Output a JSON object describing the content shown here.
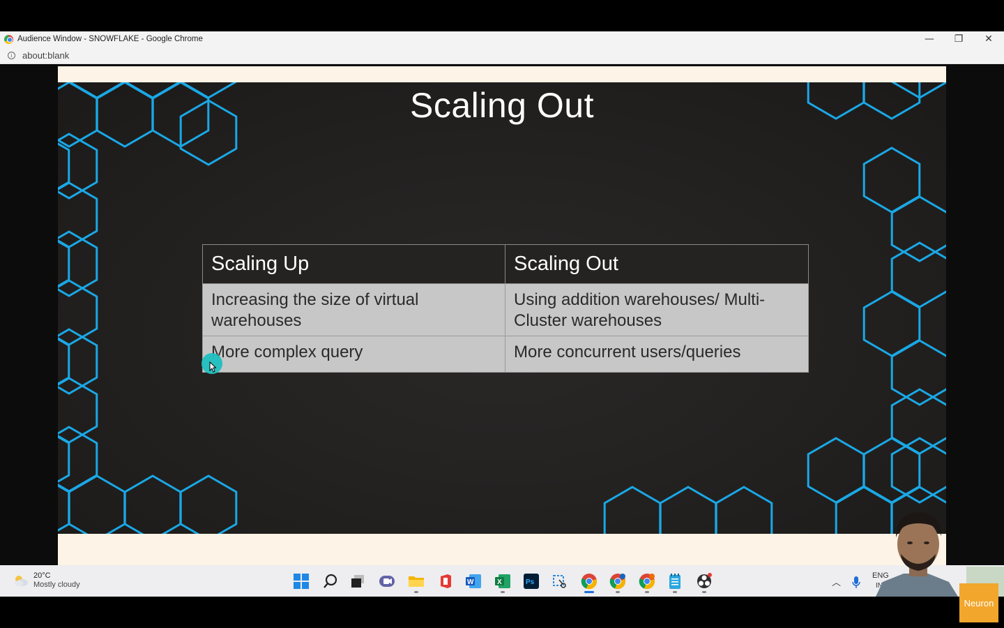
{
  "window": {
    "title": "Audience Window - SNOWFLAKE - Google Chrome",
    "url": "about:blank"
  },
  "slide": {
    "title": "Scaling Out",
    "table": {
      "headers": [
        "Scaling Up",
        "Scaling Out"
      ],
      "rows": [
        [
          "Increasing the size of virtual warehouses",
          "Using addition warehouses/ Multi-Cluster warehouses"
        ],
        [
          "More complex query",
          "More concurrent users/queries"
        ]
      ]
    },
    "accent_color": "#1aa8e6"
  },
  "taskbar": {
    "weather": {
      "temp": "20°C",
      "description": "Mostly cloudy"
    },
    "apps": [
      "start-icon",
      "search-icon",
      "task-view-icon",
      "teams-icon",
      "file-explorer-icon",
      "office-icon",
      "word-icon",
      "excel-icon",
      "photoshop-icon",
      "snipping-tool-icon",
      "chrome-icon",
      "chrome-profile-icon",
      "chrome-profile-2-icon",
      "notepad-icon",
      "obs-icon"
    ],
    "tray": {
      "lang": "ENG",
      "lang_sub": "IN"
    }
  },
  "overlay": {
    "brand": "Neuron"
  }
}
